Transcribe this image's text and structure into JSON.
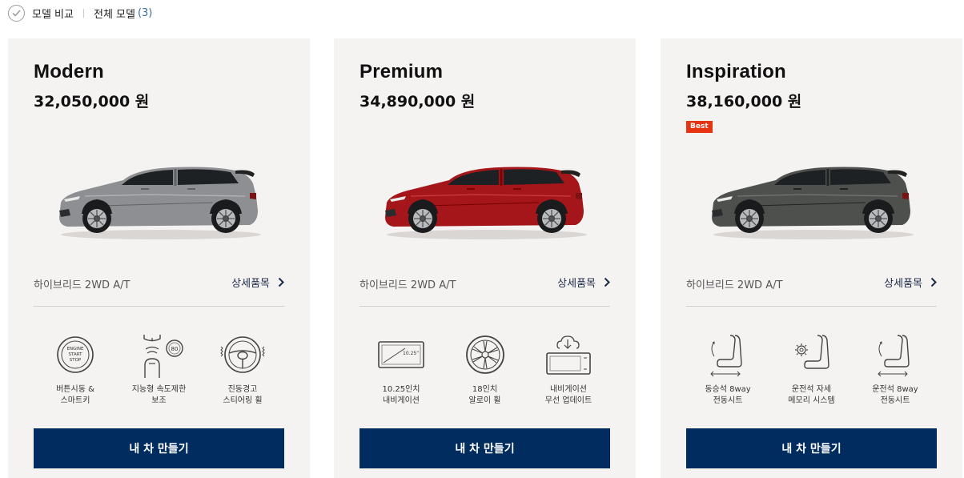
{
  "topbar": {
    "compare_label": "모델 비교",
    "all_models_label": "전체 모델",
    "all_models_count": "(3)"
  },
  "cards": [
    {
      "name": "Modern",
      "price": "32,050,000 원",
      "badge": "",
      "car_color": "#8e8f93",
      "trim": "하이브리드 2WD A/T",
      "detail_label": "상세품목",
      "features": [
        {
          "icon": "engine-start-icon",
          "label": "버튼시동 &\n스마트키"
        },
        {
          "icon": "speed-limit-icon",
          "label": "지능형 속도제한\n보조"
        },
        {
          "icon": "vibrating-steering-wheel-icon",
          "label": "진동경고\n스티어링 휠"
        }
      ],
      "cta_label": "내 차 만들기"
    },
    {
      "name": "Premium",
      "price": "34,890,000 원",
      "badge": "",
      "car_color": "#a4161a",
      "trim": "하이브리드 2WD A/T",
      "detail_label": "상세품목",
      "features": [
        {
          "icon": "navigation-screen-icon",
          "label": "10.25인치\n내비게이션"
        },
        {
          "icon": "alloy-wheel-icon",
          "label": "18인치\n알로이 휠"
        },
        {
          "icon": "ota-update-icon",
          "label": "내비게이션\n무선 업데이트"
        }
      ],
      "cta_label": "내 차 만들기"
    },
    {
      "name": "Inspiration",
      "price": "38,160,000 원",
      "badge": "Best",
      "car_color": "#4d504d",
      "trim": "하이브리드 2WD A/T",
      "detail_label": "상세품목",
      "features": [
        {
          "icon": "power-seat-icon",
          "label": "동승석 8way\n전동시트"
        },
        {
          "icon": "seat-memory-icon",
          "label": "운전석 자세\n메모리 시스템"
        },
        {
          "icon": "power-seat-icon",
          "label": "운전석 8way\n전동시트"
        }
      ],
      "cta_label": "내 차 만들기"
    }
  ],
  "screen_label": "10.25\""
}
